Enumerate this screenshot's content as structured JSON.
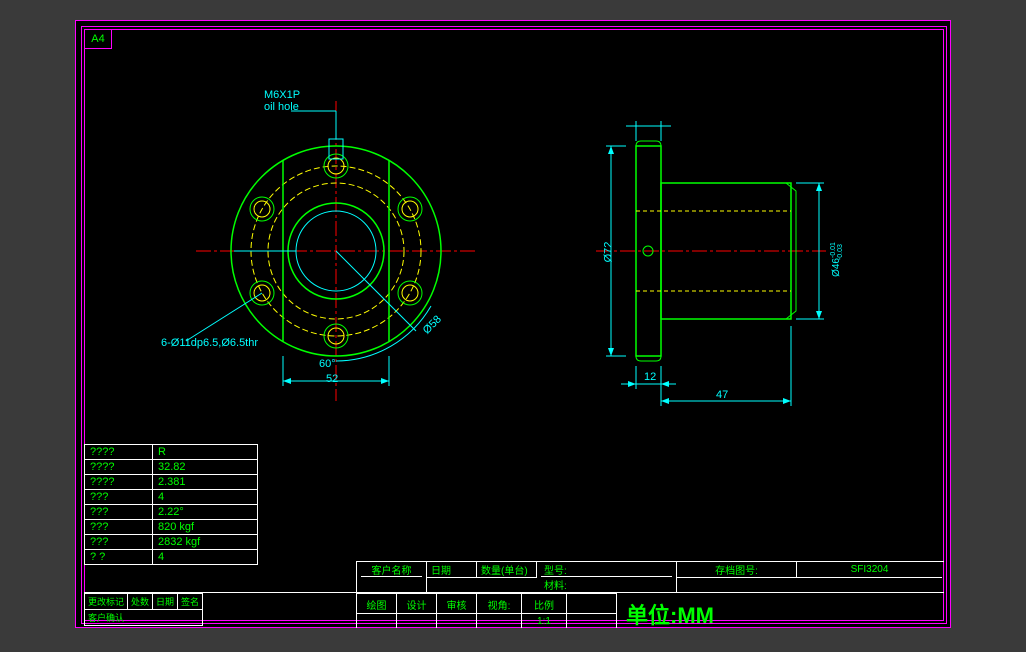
{
  "sheet": "A4",
  "annotations": {
    "oil_hole_1": "M6X1P",
    "oil_hole_2": "oil hole",
    "bolt_note": "6-Ø11dp6.5,Ø6.5thr",
    "dia58": "Ø58",
    "angle60": "60°",
    "dim52": "52",
    "dia72": "Ø72",
    "dia46": "Ø46-0.01 -0.03",
    "dia46_main": "Ø46",
    "dia46_tol1": "-0.01",
    "dia46_tol2": "-0.03",
    "dim12": "12",
    "dim47": "47"
  },
  "spec_rows": [
    {
      "l": "????",
      "v": "R"
    },
    {
      "l": "????",
      "v": "32.82"
    },
    {
      "l": "????",
      "v": "2.381"
    },
    {
      "l": "???",
      "v": "4"
    },
    {
      "l": "???",
      "v": "2.22°"
    },
    {
      "l": "???",
      "v": "820 kgf"
    },
    {
      "l": "???",
      "v": "2832 kgf"
    },
    {
      "l": "? ?",
      "v": "4"
    }
  ],
  "title_top": {
    "customer": "客户名称",
    "date": "日期",
    "qty": "数量(单台)",
    "model": "型号:",
    "drawing_no_label": "存档图号:",
    "drawing_no": "SFI3204",
    "material": "材料:"
  },
  "title_block": {
    "change_mark": "更改标记",
    "location": "处数",
    "date2": "日期",
    "sign": "签名",
    "customer_confirm": "客户确认",
    "draw": "绘图",
    "design": "设计",
    "check": "审核",
    "view": "视角:",
    "scale_label": "比例",
    "scale": "1:1"
  },
  "units": "单位:MM"
}
